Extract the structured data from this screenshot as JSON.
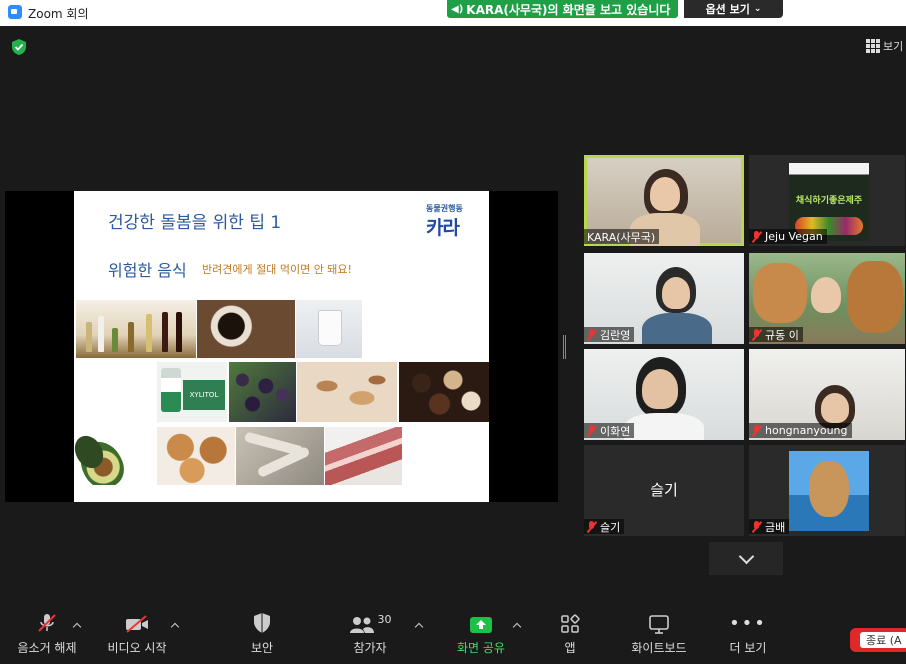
{
  "titlebar": {
    "title": "Zoom 회의"
  },
  "share_banner": {
    "text": "KARA(사무국)의 화면을 보고 있습니다",
    "view_options": "옵션 보기"
  },
  "top_right": {
    "view_label": "보기"
  },
  "slide": {
    "title": "건강한 돌봄을 위한 팁 1",
    "subtitle": "위험한 음식",
    "note": "반려견에게 절대 먹이면 안 돼요!",
    "logo_top": "동물권행동",
    "logo_main": "카라",
    "xylitol_label": "XYLITOL"
  },
  "participants": [
    {
      "name": "KARA(사무국)",
      "muted": false,
      "active": true
    },
    {
      "name": "Jeju Vegan",
      "muted": true,
      "poster_text": "채식하기좋은제주"
    },
    {
      "name": "김란영",
      "muted": true
    },
    {
      "name": "규동 이",
      "muted": true
    },
    {
      "name": "이화연",
      "muted": true
    },
    {
      "name": "hongnanyoung",
      "muted": true
    },
    {
      "name": "슬기",
      "muted": true,
      "center_name": "슬기"
    },
    {
      "name": "금배",
      "muted": true
    }
  ],
  "toolbar": {
    "mute": "음소거 해제",
    "video": "비디오 시작",
    "security": "보안",
    "participants": "참가자",
    "participants_count": "30",
    "share": "화면 공유",
    "apps": "앱",
    "whiteboard": "화이트보드",
    "more": "더 보기",
    "end": "종료 (A"
  },
  "colors": {
    "share_green": "#1fa046",
    "active_outline": "#b8d84a",
    "end_red": "#e02828"
  }
}
